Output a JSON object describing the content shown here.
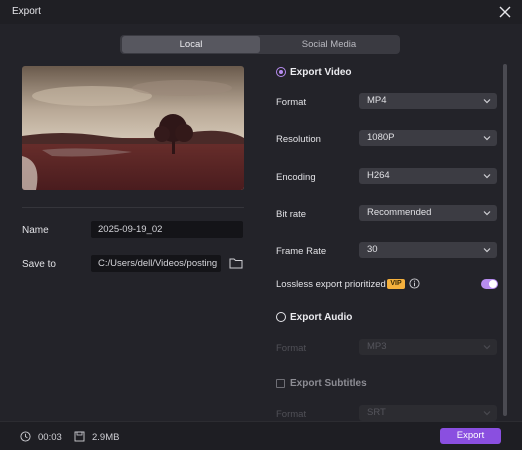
{
  "window": {
    "title": "Export"
  },
  "tabs": [
    {
      "label": "Local"
    },
    {
      "label": "Social Media"
    }
  ],
  "left": {
    "name_label": "Name",
    "name_value": "2025-09-19_02",
    "save_label": "Save to",
    "save_path": "C:/Users/dell/Videos/posting"
  },
  "export_video": {
    "title": "Export Video",
    "rows": [
      {
        "label": "Format",
        "value": "MP4"
      },
      {
        "label": "Resolution",
        "value": "1080P"
      },
      {
        "label": "Encoding",
        "value": "H264"
      },
      {
        "label": "Bit rate",
        "value": "Recommended"
      },
      {
        "label": "Frame Rate",
        "value": "30"
      }
    ],
    "lossless_label": "Lossless export prioritized",
    "vip_badge": "VIP",
    "lossless_enabled": true
  },
  "export_audio": {
    "title": "Export Audio",
    "format_label": "Format",
    "format_value": "MP3"
  },
  "export_subtitles": {
    "title": "Export Subtitles",
    "format_label": "Format",
    "format_value": "SRT"
  },
  "footer": {
    "duration": "00:03",
    "size": "2.9MB",
    "export_label": "Export"
  },
  "colors": {
    "accent": "#8a4fe0",
    "toggle": "#b78cf0",
    "vip": "#f5b13d"
  }
}
